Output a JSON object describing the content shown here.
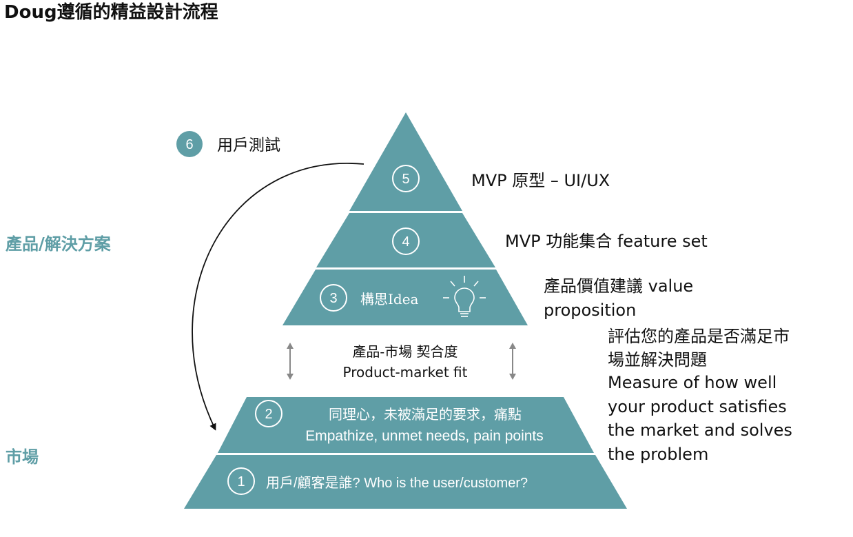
{
  "title": "Doug遵循的精益設計流程",
  "side_labels": {
    "product": "產品/解決方案",
    "market": "市場"
  },
  "colors": {
    "teal": "#5f9ea6",
    "side_label": "#5f9ea6"
  },
  "top_pyramid": {
    "levels": [
      {
        "number": "5",
        "text": ""
      },
      {
        "number": "4",
        "text": ""
      },
      {
        "number": "3",
        "text": "構思Idea",
        "icon": "lightbulb-icon"
      }
    ]
  },
  "bottom_pyramid": {
    "levels": [
      {
        "number": "2",
        "text_cn": "同理心，未被滿足的要求，痛點",
        "text_en": "Empathize, unmet needs, pain points"
      },
      {
        "number": "1",
        "text": "用戶/顧客是誰? Who is the user/customer?"
      }
    ]
  },
  "step6": {
    "number": "6",
    "label": "用戶測試"
  },
  "right_labels": {
    "mvp_proto": "MVP 原型 – UI/UX",
    "mvp_feature": "MVP 功能集合 feature set",
    "value_prop_1": "產品價值建議 value",
    "value_prop_2": "proposition",
    "measure": [
      "評估您的產品是否滿足市",
      "場並解決問題",
      "Measure of how well",
      "your product satisfies",
      "the market and solves",
      "the problem"
    ]
  },
  "fit": {
    "cn": "產品-市場 契合度",
    "en": "Product-market fit"
  }
}
